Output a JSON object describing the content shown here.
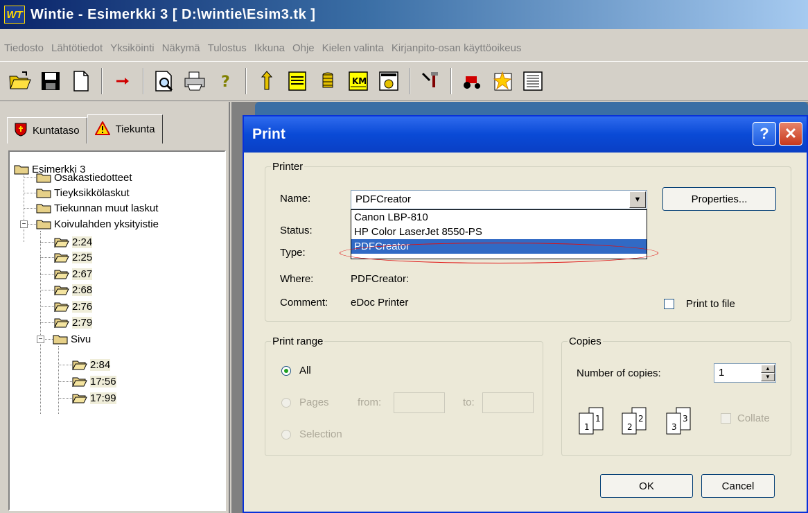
{
  "window": {
    "logo_text": "WT",
    "title": "Wintie  -  Esimerkki 3    [ D:\\wintie\\Esim3.tk ]"
  },
  "menu": [
    "Tiedosto",
    "Lähtötiedot",
    "Yksiköinti",
    "Näkymä",
    "Tulostus",
    "Ikkuna",
    "Ohje",
    "Kielen valinta",
    "Kirjanpito-osan käyttöoikeus"
  ],
  "toolbar_icons": [
    "open-folder-icon",
    "save-icon",
    "new-document-icon",
    "arrow-right-icon",
    "print-preview-icon",
    "printer-icon",
    "help-question-icon",
    "road-sign-icon",
    "document-list-icon",
    "coins-icon",
    "km-icon",
    "calculator-icon",
    "tools-icon",
    "tractor-icon",
    "sparkle-sheet-icon",
    "report-sheet-icon"
  ],
  "tabs": {
    "kuntataso": "Kuntataso",
    "tiekunta": "Tiekunta"
  },
  "tree": {
    "root": "Esimerkki 3",
    "items": [
      "Osakastiedotteet",
      "Tieyksikkölaskut",
      "Tiekunnan muut laskut",
      "Koivulahden yksityistie"
    ],
    "koivulahti_children": [
      "2:24",
      "2:25",
      "2:67",
      "2:68",
      "2:76",
      "2:79"
    ],
    "sivu": "Sivu",
    "sivu_children": [
      "2:84",
      "17:56",
      "17:99"
    ]
  },
  "dialog": {
    "title": "Print",
    "help_glyph": "?",
    "close_glyph": "✕",
    "printer": {
      "legend": "Printer",
      "name_label": "Name:",
      "name_value": "PDFCreator",
      "status_label": "Status:",
      "type_label": "Type:",
      "where_label": "Where:",
      "where_value": "PDFCreator:",
      "comment_label": "Comment:",
      "comment_value": "eDoc Printer",
      "properties_button": "Properties...",
      "print_to_file": "Print to file",
      "dropdown_options": [
        "Canon LBP-810",
        "HP Color LaserJet 8550-PS",
        "PDFCreator"
      ],
      "dropdown_selected": "PDFCreator"
    },
    "range": {
      "legend": "Print range",
      "all": "All",
      "pages": "Pages",
      "from": "from:",
      "to": "to:",
      "selection": "Selection"
    },
    "copies": {
      "legend": "Copies",
      "number_label": "Number of copies:",
      "number_value": "1",
      "collate": "Collate",
      "pages_stack": [
        "1",
        "1",
        "2",
        "2",
        "3",
        "3"
      ]
    },
    "ok_button": "OK",
    "cancel_button": "Cancel"
  }
}
